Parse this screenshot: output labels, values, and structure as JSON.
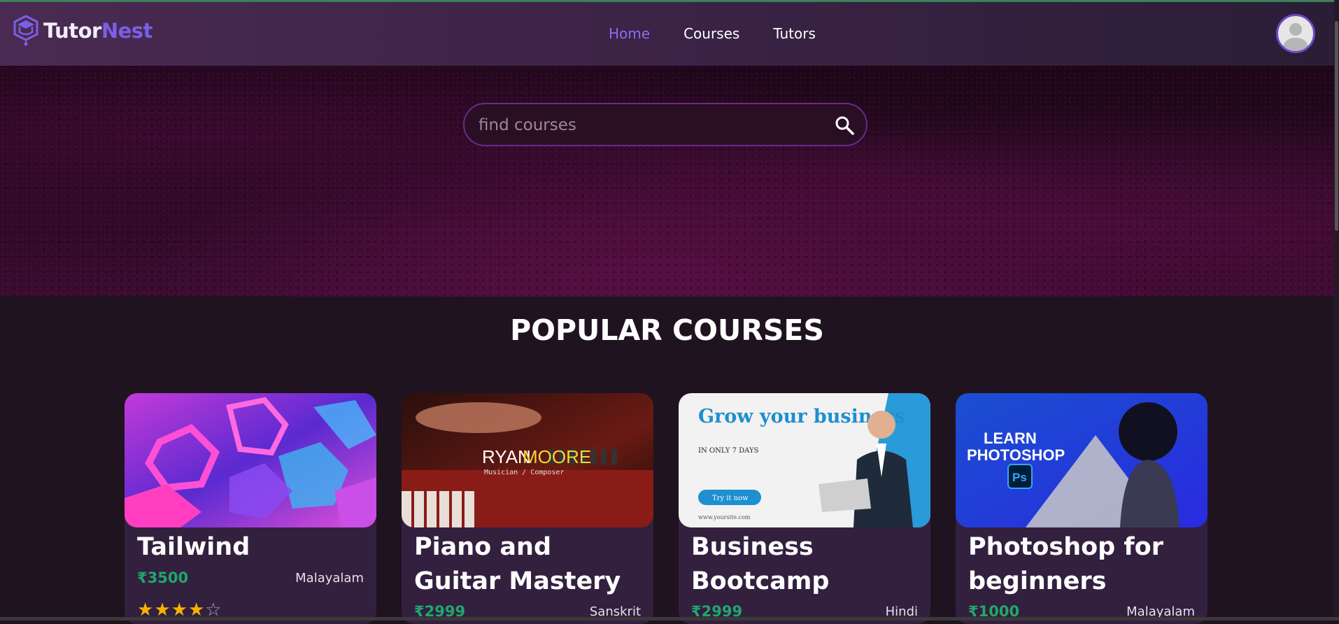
{
  "brand": {
    "part1": "Tutor",
    "part2": "Nest"
  },
  "nav": {
    "items": [
      "Home",
      "Courses",
      "Tutors"
    ],
    "active": "Home"
  },
  "search": {
    "placeholder": "find courses",
    "value": ""
  },
  "section": {
    "title": "POPULAR COURSES"
  },
  "courses": [
    {
      "title": "Tailwind",
      "price": "₹3500",
      "language": "Malayalam",
      "rating": 4,
      "max_rating": 5
    },
    {
      "title": "Piano and Guitar Mastery",
      "price": "₹2999",
      "language": "Sanskrit",
      "image_text": {
        "name_first": "RYAN",
        "name_last": "MOORE",
        "subtitle": "Musician / Composer"
      }
    },
    {
      "title": "Business Bootcamp",
      "price": "₹2999",
      "language": "Hindi",
      "image_text": {
        "headline": "Grow your business",
        "sub": "IN ONLY 7 DAYS",
        "button": "Try it now",
        "url": "www.yoursite.com"
      }
    },
    {
      "title": "Photoshop for beginners",
      "price": "₹1000",
      "language": "Malayalam",
      "image_text": {
        "headline1": "LEARN",
        "headline2": "PHOTOSHOP",
        "badge": "Ps"
      }
    }
  ],
  "colors": {
    "accent": "#7a60e6",
    "price": "#1ea86a",
    "star": "#f5b301",
    "card_bg": "#33203f",
    "page_bg": "#1f1320"
  }
}
